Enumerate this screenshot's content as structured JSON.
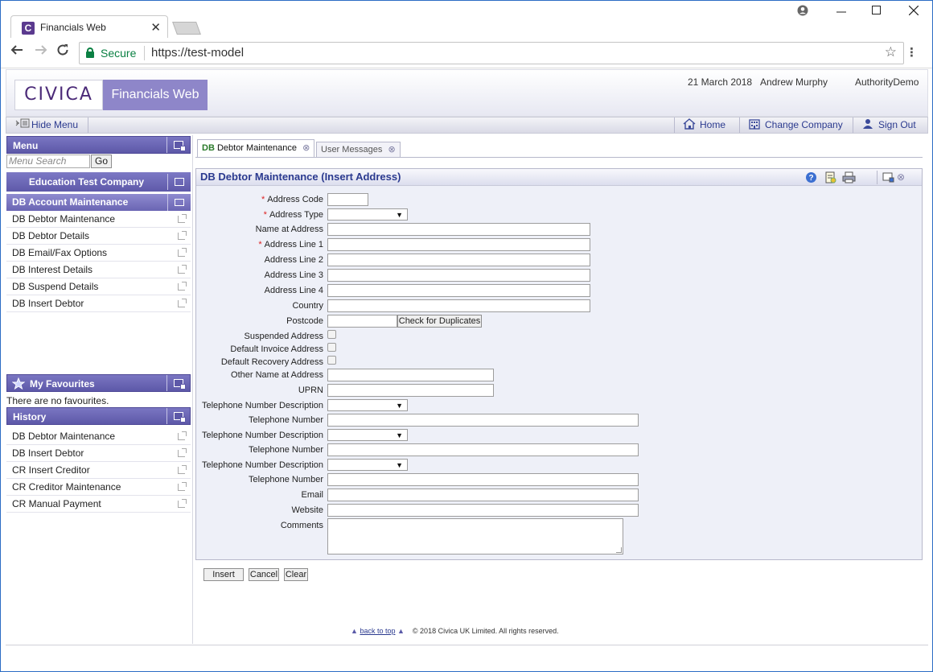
{
  "browser": {
    "tab_title": "Financials Web",
    "tab_close": "✕",
    "secure_label": "Secure",
    "url": "https://test-model"
  },
  "header": {
    "logo_text": "CIVICA",
    "product_name": "Financials Web",
    "date": "21 March 2018",
    "user": "Andrew Murphy",
    "authority": "AuthorityDemo"
  },
  "toolbar": {
    "hide_menu": "Hide Menu",
    "home": "Home",
    "change_company": "Change Company",
    "sign_out": "Sign Out"
  },
  "sidebar": {
    "menu_title": "Menu",
    "search_placeholder": "Menu Search",
    "go_label": "Go",
    "company": "Education Test Company",
    "selected_group": "DB Account Maintenance",
    "items": [
      "DB Debtor Maintenance",
      "DB Debtor Details",
      "DB Email/Fax Options",
      "DB Interest Details",
      "DB Suspend Details",
      "DB Insert Debtor"
    ],
    "favourites_title": "My Favourites",
    "favourites_empty": "There are no favourites.",
    "history_title": "History",
    "history": [
      "DB Debtor Maintenance",
      "DB Insert Debtor",
      "CR Insert Creditor",
      "CR Creditor Maintenance",
      "CR Manual Payment"
    ]
  },
  "tabs": {
    "active_prefix": "DB",
    "active_label": "Debtor Maintenance",
    "second_label": "User Messages"
  },
  "panel": {
    "title": "DB Debtor Maintenance (Insert Address)"
  },
  "form": {
    "address_code": "Address Code",
    "address_type": "Address Type",
    "name_at_address": "Name at Address",
    "address_line_1": "Address Line 1",
    "address_line_2": "Address Line 2",
    "address_line_3": "Address Line 3",
    "address_line_4": "Address Line 4",
    "country": "Country",
    "postcode": "Postcode",
    "check_duplicates": "Check for Duplicates",
    "suspended_address": "Suspended Address",
    "default_invoice_address": "Default Invoice Address",
    "default_recovery_address": "Default Recovery Address",
    "other_name_at_address": "Other Name at Address",
    "uprn": "UPRN",
    "telephone_number_description": "Telephone Number Description",
    "telephone_number": "Telephone Number",
    "email": "Email",
    "website": "Website",
    "comments": "Comments",
    "required_mark": "*"
  },
  "actions": {
    "insert": "Insert",
    "cancel": "Cancel",
    "clear": "Clear"
  },
  "footer": {
    "back_to_top": "back to top",
    "copyright": "© 2018 Civica UK Limited. All rights reserved."
  },
  "colors": {
    "brand_purple": "#5d58a8",
    "link_blue": "#2b3a8f",
    "required_red": "#dd2222",
    "secure_green": "#0b8043"
  }
}
